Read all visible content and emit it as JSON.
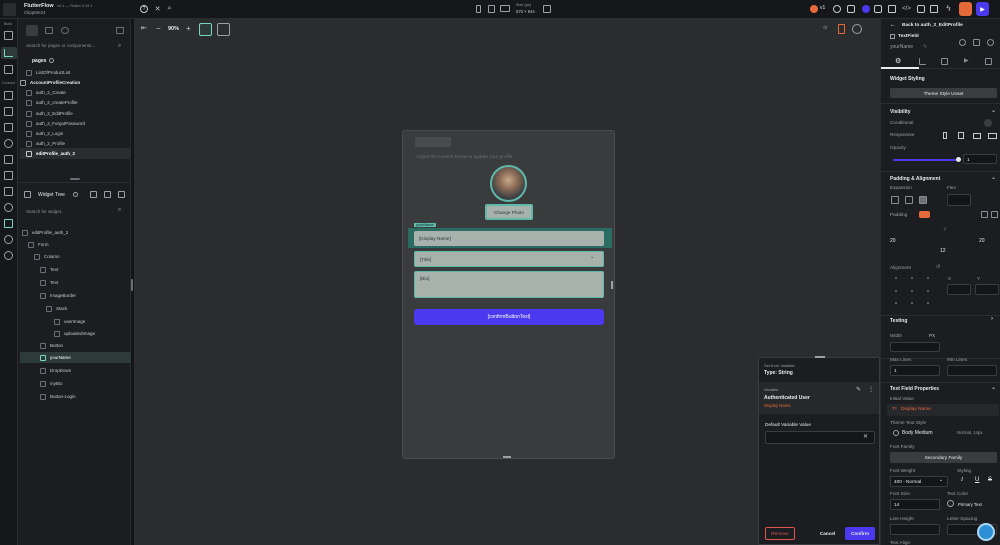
{
  "app": {
    "title": "FlutterFlow",
    "version": "v4.1 — Flutter 3.19.1",
    "project": "ClippMe24"
  },
  "topbar": {
    "device_title": "Size (px)",
    "device_size": "570 × 944",
    "version_badge": "v1"
  },
  "rail": {
    "build_label": "Build",
    "connect_label": "Connect"
  },
  "pages_panel": {
    "search_placeholder": "Search for pages or components...",
    "section_pages": "pages",
    "items": [
      {
        "label": "ListOfProductList"
      },
      {
        "label": "AccountProfileCreation"
      },
      {
        "label": "auth_2_Create"
      },
      {
        "label": "auth_2_createProfile"
      },
      {
        "label": "auth_2_EditProfile"
      },
      {
        "label": "auth_2_ForgotPassword"
      },
      {
        "label": "auth_2_Login"
      },
      {
        "label": "auth_2_Profile"
      },
      {
        "label": "editProfile_auth_2"
      }
    ]
  },
  "widget_tree": {
    "title": "Widget Tree",
    "search_placeholder": "Search for widget...",
    "items": [
      {
        "label": "editProfile_auth_2"
      },
      {
        "label": "Form"
      },
      {
        "label": "Column"
      },
      {
        "label": "Text"
      },
      {
        "label": "Text"
      },
      {
        "label": "ImageBorder"
      },
      {
        "label": "Stack"
      },
      {
        "label": "userImage"
      },
      {
        "label": "uploadedImage"
      },
      {
        "label": "Button"
      },
      {
        "label": "yourName"
      },
      {
        "label": "DropDown"
      },
      {
        "label": "myBio"
      },
      {
        "label": "Button-Login"
      }
    ]
  },
  "canvas": {
    "zoom": "90%",
    "subtitle": "Adjust the content below to update your profile.",
    "change_photo": "Change Photo",
    "field_tag": "yourName",
    "display_name": "[Display Name]",
    "title_field": "[Title]",
    "bio_field": "[Bio]",
    "confirm_button": "[confirmButtonText]"
  },
  "variable_popup": {
    "set_from": "Set from Variable",
    "type": "Type: String",
    "variable_label": "Variable",
    "variable_value": "Authenticated User",
    "variable_sub": "Display Name",
    "default_label": "Default Variable Value",
    "remove": "Remove",
    "cancel": "Cancel",
    "confirm": "Confirm"
  },
  "right_panel": {
    "back": "Back to auth_2_EditProfile",
    "widget_type": "TextField",
    "widget_name": "yourName",
    "widget_styling": "Widget Styling",
    "theme_unset": "Theme Style Unset",
    "visibility": "Visibility",
    "conditional": "Conditional",
    "responsive": "Responsive",
    "opacity": "Opacity",
    "opacity_value": "1",
    "padding_alignment": "Padding & Alignment",
    "expansion": "Expansion",
    "flex": "Flex",
    "padding": "Padding",
    "pad_left": "20",
    "pad_right": "20",
    "pad_bottom": "12",
    "alignment": "Alignment",
    "align_x": "X",
    "align_y": "Y",
    "testing": "Testing",
    "width": "Width",
    "px": "PX",
    "max_lines": "Max Lines",
    "max_lines_value": "1",
    "min_lines": "Min Lines",
    "tf_props": "Text Field Properties",
    "initial_value": "Initial Value",
    "initial_value_text": "Display Name",
    "theme_text_style": "Theme Text Style",
    "body_medium": "Body Medium",
    "normal_size": "Normal, 14px",
    "font_family": "Font Family",
    "secondary_family": "Secondary Family",
    "font_weight": "Font Weight",
    "styling": "Styling",
    "weight_value": "400 - Normal",
    "font_size": "Font Size",
    "font_size_value": "14",
    "text_color": "Text Color",
    "text_color_value": "Primary Text",
    "line_height": "Line Height",
    "letter_spacing": "Letter Spacing",
    "text_align": "Text Align"
  },
  "colors": {
    "accent": "#4b39ef",
    "teal": "#2c6b62",
    "orange": "#e56a3a",
    "field_bg": "#a8b2ad"
  }
}
